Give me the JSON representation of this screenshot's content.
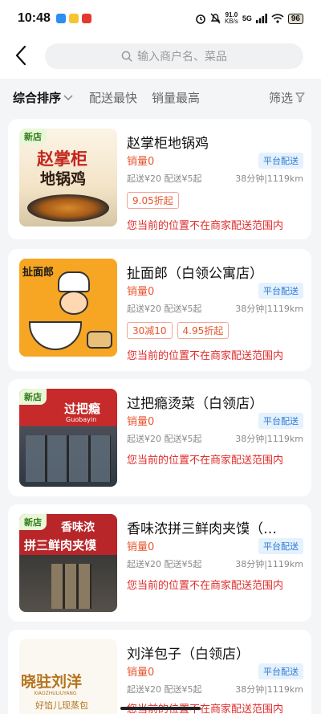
{
  "status": {
    "time": "10:48",
    "net_speed": "91.0",
    "net_unit": "KB/s",
    "signal": "5G",
    "battery": "96"
  },
  "search": {
    "placeholder": "输入商户名、菜品"
  },
  "sort": {
    "composite": "综合排序",
    "fastest": "配送最快",
    "top_sales": "销量最高",
    "filter": "筛选"
  },
  "shops": [
    {
      "name": "赵掌柜地锅鸡",
      "is_new": true,
      "new_label": "新店",
      "sales": "销量0",
      "delivery_badge": "平台配送",
      "fees": "起送¥20 配送¥5起",
      "eta_distance": "38分钟|1119km",
      "promos": [
        "9.05折起"
      ],
      "warning": "您当前的位置不在商家配送范围内",
      "thumb_text_1": "赵掌柜",
      "thumb_text_2": "地锅鸡"
    },
    {
      "name": "扯面郎（白领公寓店）",
      "is_new": false,
      "sales": "销量0",
      "delivery_badge": "平台配送",
      "fees": "起送¥20 配送¥5起",
      "eta_distance": "38分钟|1119km",
      "promos": [
        "30减10",
        "4.95折起"
      ],
      "warning": "您当前的位置不在商家配送范围内",
      "thumb_text_1": "扯面郎"
    },
    {
      "name": "过把瘾烫菜（白领店）",
      "is_new": true,
      "new_label": "新店",
      "sales": "销量0",
      "delivery_badge": "平台配送",
      "fees": "起送¥20 配送¥5起",
      "eta_distance": "38分钟|1119km",
      "promos": [],
      "warning": "您当前的位置不在商家配送范围内",
      "thumb_text_1": "过把瘾",
      "thumb_text_2": "Guobayin"
    },
    {
      "name": "香味浓拼三鲜肉夹馍（…",
      "is_new": true,
      "new_label": "新店",
      "sales": "销量0",
      "delivery_badge": "平台配送",
      "fees": "起送¥20 配送¥5起",
      "eta_distance": "38分钟|1119km",
      "promos": [],
      "warning": "您当前的位置不在商家配送范围内",
      "thumb_text_1": "香味浓",
      "thumb_text_2": "拼三鲜肉夹馍"
    },
    {
      "name": "刘洋包子（白领店）",
      "is_new": false,
      "sales": "销量0",
      "delivery_badge": "平台配送",
      "fees": "起送¥20 配送¥5起",
      "eta_distance": "38分钟|1119km",
      "promos": [],
      "warning": "您当前的位置不在商家配送范围内",
      "thumb_text_1": "晓驻刘洋",
      "thumb_text_2": "XIAOZHULIUYANG",
      "thumb_text_3": "好馅儿现蒸包"
    }
  ],
  "colors": {
    "accent": "#e8542e",
    "warning": "#e02b2b",
    "badge_blue": "#2d7ad6",
    "new_green": "#2f7a1a"
  }
}
